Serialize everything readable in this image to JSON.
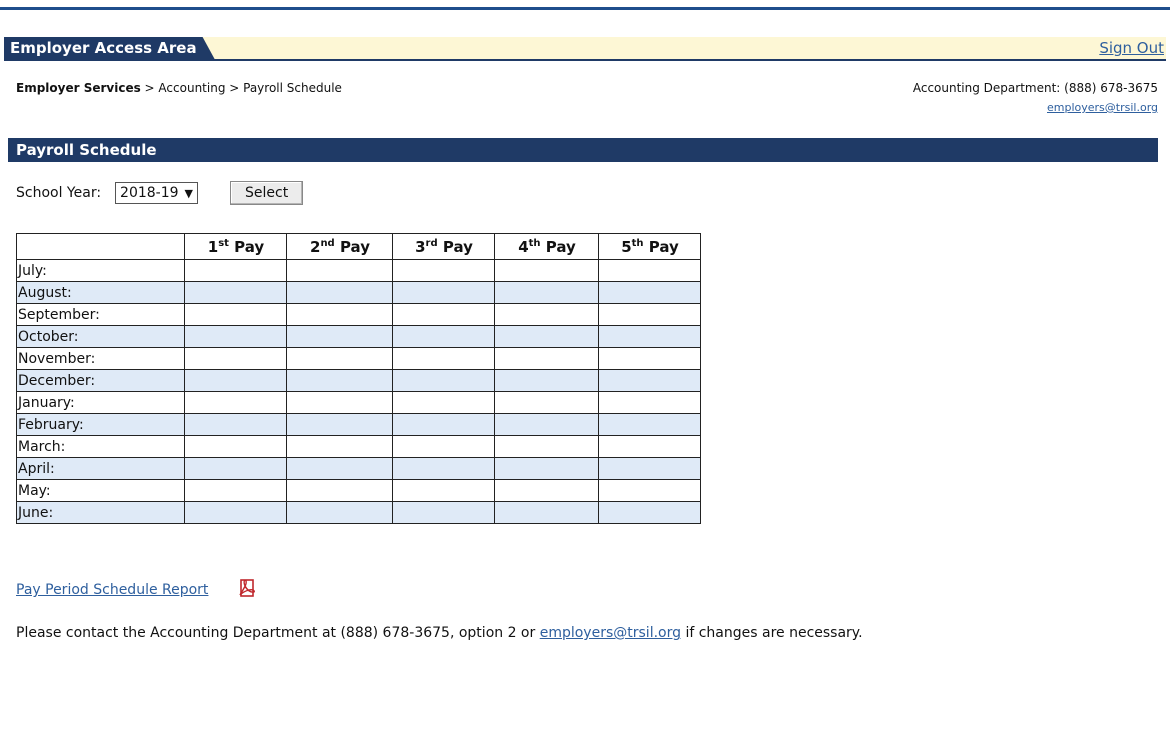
{
  "header": {
    "area_title": "Employer Access Area",
    "sign_out": "Sign Out"
  },
  "breadcrumb": {
    "root": "Employer Services",
    "sep1": " > ",
    "level2": "Accounting",
    "sep2": " > ",
    "current": "Payroll Schedule"
  },
  "contact": {
    "phone_line": "Accounting Department: (888) 678-3675",
    "email": "employers@trsil.org"
  },
  "section": {
    "title": "Payroll Schedule"
  },
  "filter": {
    "label": "School Year:",
    "selected_year": "2018-19",
    "select_button": "Select"
  },
  "table": {
    "columns": [
      {
        "num": "1",
        "sup": "st",
        "label": " Pay"
      },
      {
        "num": "2",
        "sup": "nd",
        "label": " Pay"
      },
      {
        "num": "3",
        "sup": "rd",
        "label": " Pay"
      },
      {
        "num": "4",
        "sup": "th",
        "label": " Pay"
      },
      {
        "num": "5",
        "sup": "th",
        "label": " Pay"
      }
    ],
    "months": [
      "July:",
      "August:",
      "September:",
      "October:",
      "November:",
      "December:",
      "January:",
      "February:",
      "March:",
      "April:",
      "May:",
      "June:"
    ]
  },
  "report": {
    "link_text": "Pay Period Schedule Report",
    "icon": "pdf-icon"
  },
  "footer": {
    "prefix": "Please contact the Accounting Department at (888) 678-3675, option 2 or ",
    "email": "employers@trsil.org",
    "suffix": " if changes are necessary."
  },
  "colors": {
    "navy": "#1f3a66",
    "link": "#2e5f9e",
    "tab_bg": "#fdf7d5",
    "alt_row": "#dfeaf7",
    "pdf_red": "#c0282d"
  }
}
